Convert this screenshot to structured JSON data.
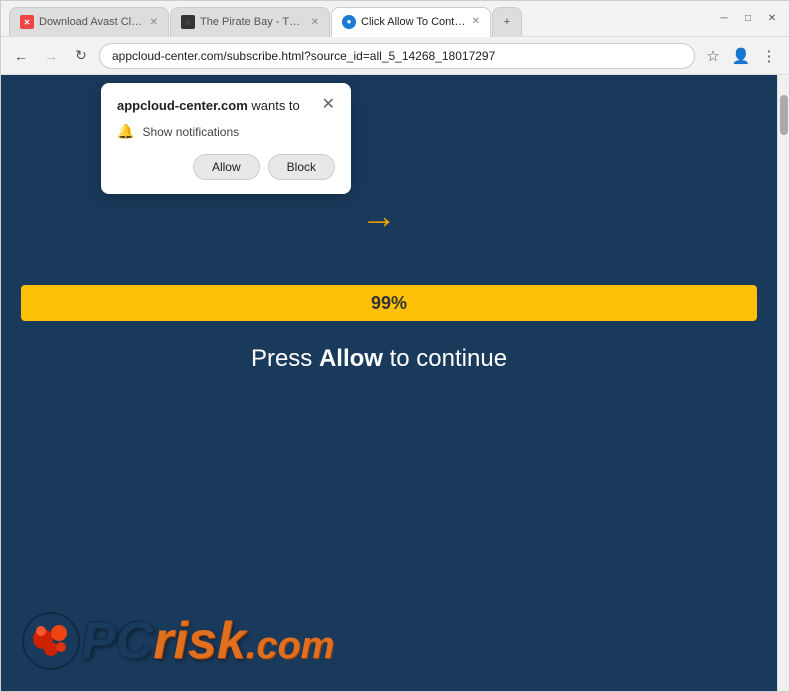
{
  "browser": {
    "title": "Click Allow To Continue -",
    "tabs": [
      {
        "id": "tab1",
        "label": "Download Avast Cleanup & Bo",
        "active": false,
        "favicon": "x"
      },
      {
        "id": "tab2",
        "label": "The Pirate Bay - The galaxy's m",
        "active": false,
        "favicon": "pirate"
      },
      {
        "id": "tab3",
        "label": "Click Allow To Continue -",
        "active": true,
        "favicon": "click"
      }
    ],
    "address": "appcloud-center.com/subscribe.html?source_id=all_5_14268_18017297",
    "nav": {
      "back_disabled": false,
      "forward_disabled": true
    }
  },
  "notification_popup": {
    "site": "appcloud-center.com",
    "wants_to": " wants to",
    "description": "Show notifications",
    "allow_label": "Allow",
    "block_label": "Block"
  },
  "page": {
    "progress_value": "99%",
    "message_prefix": "Press ",
    "message_bold": "Allow",
    "message_suffix": " to continue"
  },
  "pcrisk": {
    "pc_text": "PC",
    "risk_text": "risk",
    "com_text": ".com"
  },
  "colors": {
    "background": "#1a3a5c",
    "progress": "#ffc107",
    "arrow": "#f0a500",
    "pcrisk_orange": "#e07020"
  }
}
